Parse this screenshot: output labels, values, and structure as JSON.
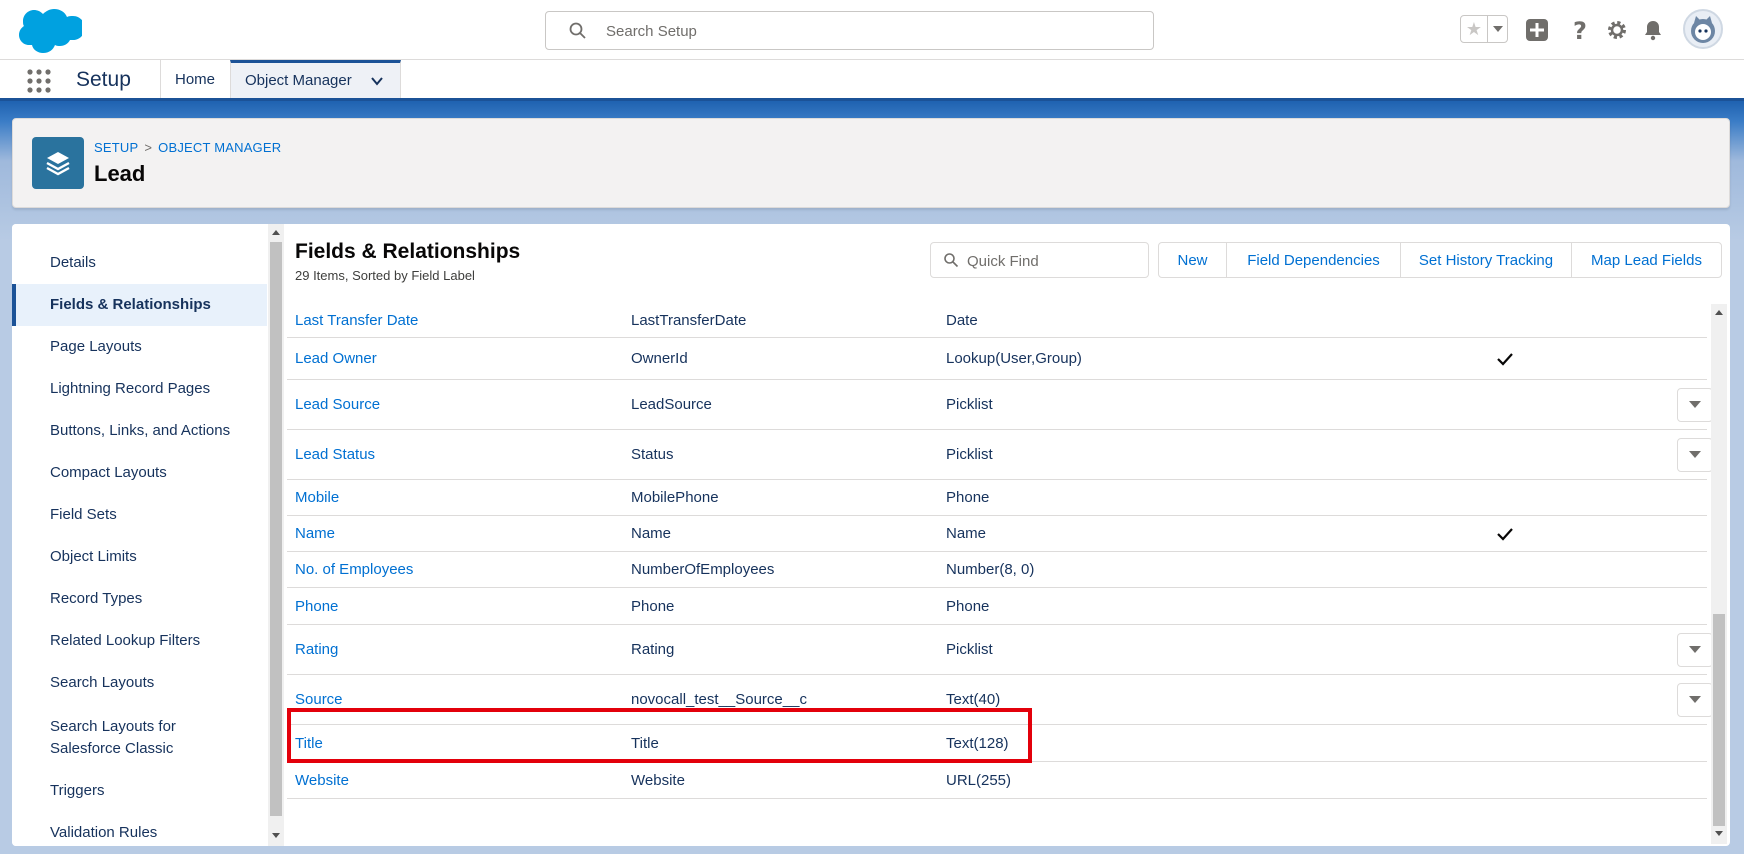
{
  "colors": {
    "brand": "#00a1e0",
    "link": "#0070d2",
    "active_nav": "#1b5297",
    "highlight": "#e3000b"
  },
  "global_header": {
    "search_placeholder": "Search Setup",
    "icons": [
      "search-icon",
      "favorite-star-icon",
      "chevron-down-icon",
      "add-icon",
      "help-icon",
      "gear-icon",
      "bell-icon",
      "avatar"
    ]
  },
  "context_bar": {
    "app_name": "Setup",
    "tabs": [
      {
        "label": "Home"
      },
      {
        "label": "Object Manager"
      }
    ]
  },
  "page_header": {
    "breadcrumb": [
      "SETUP",
      "OBJECT MANAGER"
    ],
    "breadcrumb_sep": ">",
    "title": "Lead"
  },
  "sidebar": {
    "items": [
      {
        "label": "Details"
      },
      {
        "label": "Fields & Relationships",
        "active": true
      },
      {
        "label": "Page Layouts"
      },
      {
        "label": "Lightning Record Pages"
      },
      {
        "label": "Buttons, Links, and Actions"
      },
      {
        "label": "Compact Layouts"
      },
      {
        "label": "Field Sets"
      },
      {
        "label": "Object Limits"
      },
      {
        "label": "Record Types"
      },
      {
        "label": "Related Lookup Filters"
      },
      {
        "label": "Search Layouts"
      },
      {
        "label": "Search Layouts for Salesforce Classic"
      },
      {
        "label": "Triggers"
      },
      {
        "label": "Validation Rules"
      }
    ]
  },
  "section": {
    "title": "Fields & Relationships",
    "subtitle": "29 Items, Sorted by Field Label",
    "quick_find_placeholder": "Quick Find",
    "buttons": [
      "New",
      "Field Dependencies",
      "Set History Tracking",
      "Map Lead Fields"
    ]
  },
  "fields": [
    {
      "label": "Last Transfer Date",
      "api": "LastTransferDate",
      "type": "Date",
      "indexed": false,
      "menu": false
    },
    {
      "label": "Lead Owner",
      "api": "OwnerId",
      "type": "Lookup(User,Group)",
      "indexed": true,
      "menu": false
    },
    {
      "label": "Lead Source",
      "api": "LeadSource",
      "type": "Picklist",
      "indexed": false,
      "menu": true
    },
    {
      "label": "Lead Status",
      "api": "Status",
      "type": "Picklist",
      "indexed": false,
      "menu": true
    },
    {
      "label": "Mobile",
      "api": "MobilePhone",
      "type": "Phone",
      "indexed": false,
      "menu": false
    },
    {
      "label": "Name",
      "api": "Name",
      "type": "Name",
      "indexed": true,
      "menu": false
    },
    {
      "label": "No. of Employees",
      "api": "NumberOfEmployees",
      "type": "Number(8, 0)",
      "indexed": false,
      "menu": false
    },
    {
      "label": "Phone",
      "api": "Phone",
      "type": "Phone",
      "indexed": false,
      "menu": false
    },
    {
      "label": "Rating",
      "api": "Rating",
      "type": "Picklist",
      "indexed": false,
      "menu": true
    },
    {
      "label": "Source",
      "api": "novocall_test__Source__c",
      "type": "Text(40)",
      "indexed": false,
      "menu": true,
      "highlighted": true
    },
    {
      "label": "Title",
      "api": "Title",
      "type": "Text(128)",
      "indexed": false,
      "menu": false
    },
    {
      "label": "Website",
      "api": "Website",
      "type": "URL(255)",
      "indexed": false,
      "menu": false
    }
  ]
}
